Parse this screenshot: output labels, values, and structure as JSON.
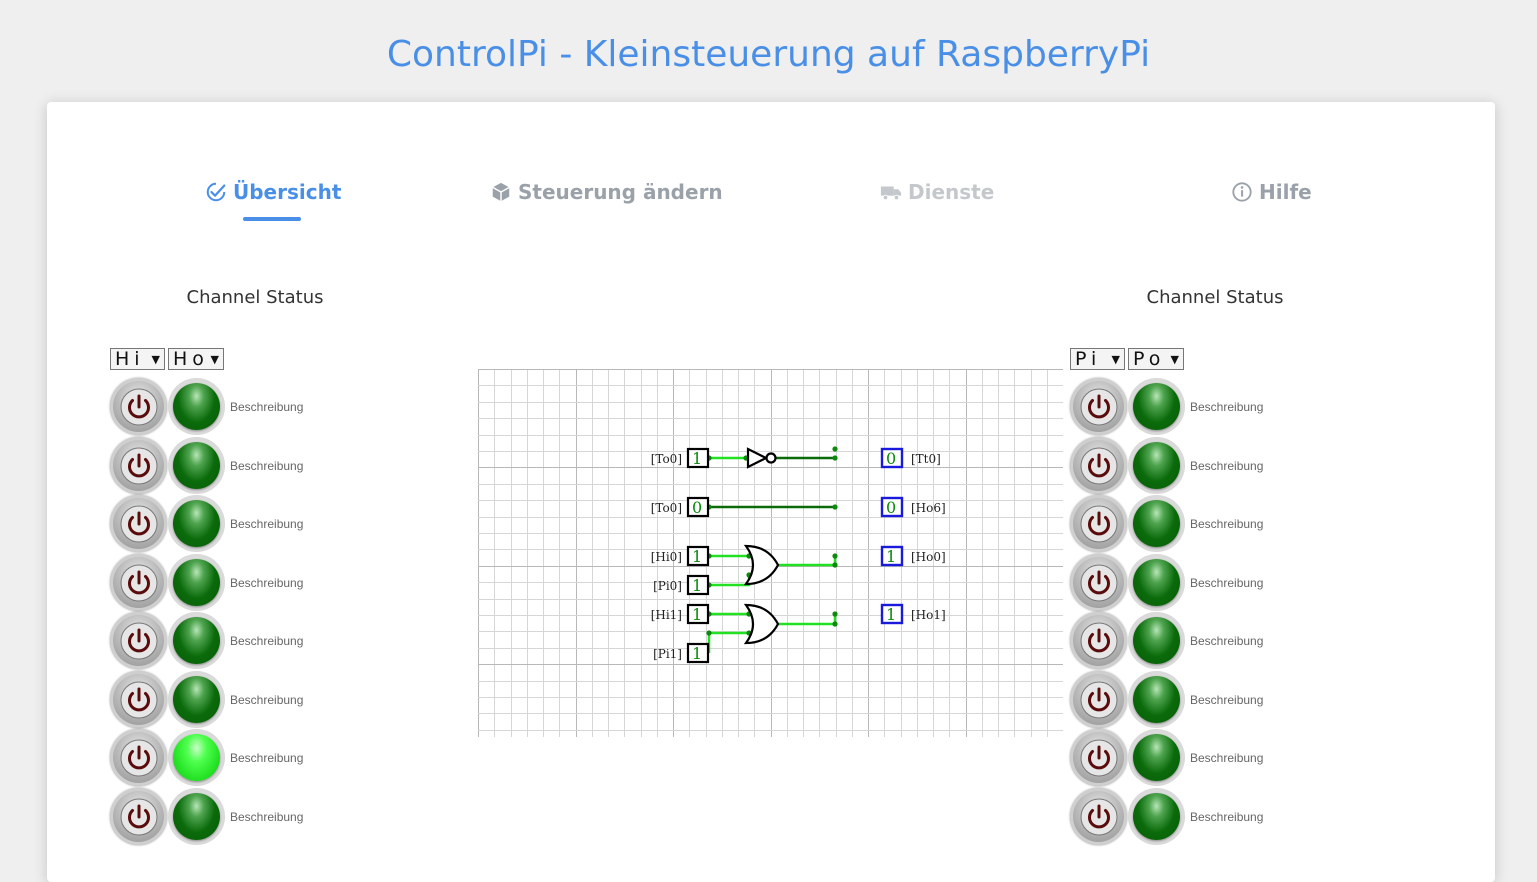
{
  "app_title": "ControlPi - Kleinsteuerung auf RaspberryPi",
  "tabs": [
    {
      "label": "Übersicht",
      "icon": "check-badge-icon",
      "active": true
    },
    {
      "label": "Steuerung ändern",
      "icon": "cube-icon",
      "active": false
    },
    {
      "label": "Dienste",
      "icon": "truck-icon",
      "active": false
    },
    {
      "label": "Hilfe",
      "icon": "info-circle-icon",
      "active": false
    }
  ],
  "accent_color": "#4a8fe7",
  "left_panel": {
    "title": "Channel Status",
    "select_a": "Hi",
    "select_b": "Ho",
    "rows": [
      {
        "description": "Beschreibung",
        "led_on": false
      },
      {
        "description": "Beschreibung",
        "led_on": false
      },
      {
        "description": "Beschreibung",
        "led_on": false
      },
      {
        "description": "Beschreibung",
        "led_on": false
      },
      {
        "description": "Beschreibung",
        "led_on": false
      },
      {
        "description": "Beschreibung",
        "led_on": false
      },
      {
        "description": "Beschreibung",
        "led_on": true
      },
      {
        "description": "Beschreibung",
        "led_on": false
      }
    ]
  },
  "right_panel": {
    "title": "Channel Status",
    "select_a": "Pi",
    "select_b": "Po",
    "rows": [
      {
        "description": "Beschreibung",
        "led_on": false
      },
      {
        "description": "Beschreibung",
        "led_on": false
      },
      {
        "description": "Beschreibung",
        "led_on": false
      },
      {
        "description": "Beschreibung",
        "led_on": false
      },
      {
        "description": "Beschreibung",
        "led_on": false
      },
      {
        "description": "Beschreibung",
        "led_on": false
      },
      {
        "description": "Beschreibung",
        "led_on": false
      },
      {
        "description": "Beschreibung",
        "led_on": false
      }
    ]
  },
  "diagram": {
    "inputs": [
      {
        "label": "[To0]",
        "value": "1"
      },
      {
        "label": "[To0]",
        "value": "0"
      },
      {
        "label": "[Hi0]",
        "value": "1"
      },
      {
        "label": "[Pi0]",
        "value": "1"
      },
      {
        "label": "[Hi1]",
        "value": "1"
      },
      {
        "label": "[Pi1]",
        "value": "1"
      }
    ],
    "outputs": [
      {
        "label": "[Tt0]",
        "value": "0"
      },
      {
        "label": "[Ho6]",
        "value": "0"
      },
      {
        "label": "[Ho0]",
        "value": "1"
      },
      {
        "label": "[Ho1]",
        "value": "1"
      }
    ],
    "gates": [
      "NOT",
      "OR",
      "OR"
    ]
  }
}
